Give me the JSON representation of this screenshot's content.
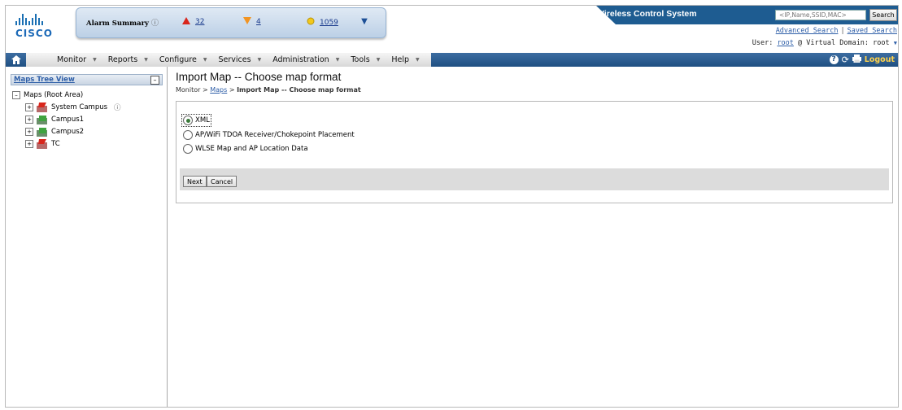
{
  "header": {
    "logo_text": "CISCO",
    "alarm_summary": {
      "label": "Alarm Summary",
      "critical_count": "32",
      "major_count": "4",
      "minor_count": "1059"
    },
    "product_title": "Wireless Control System",
    "search": {
      "placeholder": "<IP,Name,SSID,MAC>",
      "button_label": "Search"
    },
    "links": {
      "advanced_search": "Advanced Search",
      "separator": "|",
      "saved_search": "Saved Search"
    },
    "user": {
      "label": "User:",
      "name": "root",
      "domain_label": "@ Virtual Domain:",
      "domain": "root"
    }
  },
  "nav": {
    "items": [
      "Monitor",
      "Reports",
      "Configure",
      "Services",
      "Administration",
      "Tools",
      "Help"
    ],
    "logout": "Logout"
  },
  "tree": {
    "title": "Maps Tree View",
    "root": "Maps (Root Area)",
    "nodes": [
      {
        "label": "System Campus",
        "icon": "campus-alarm-icon"
      },
      {
        "label": "Campus1",
        "icon": "campus-ok-icon"
      },
      {
        "label": "Campus2",
        "icon": "campus-ok-icon"
      },
      {
        "label": "TC",
        "icon": "campus-alarm-icon"
      }
    ]
  },
  "page": {
    "title": "Import Map -- Choose map format",
    "breadcrumb": {
      "monitor": "Monitor",
      "sep1": ">",
      "maps": "Maps",
      "sep2": ">",
      "current": "Import Map -- Choose map format"
    },
    "options": [
      {
        "label": "XML",
        "selected": true
      },
      {
        "label": "AP/WiFi TDOA Receiver/Chokepoint Placement",
        "selected": false
      },
      {
        "label": "WLSE Map and AP Location Data",
        "selected": false
      }
    ],
    "next_label": "Next",
    "cancel_label": "Cancel"
  },
  "colors": {
    "nav_blue": "#1f4f82",
    "link_blue": "#2f5fa8",
    "critical_red": "#d9261c",
    "major_orange": "#f29422",
    "minor_yellow": "#f2c81a"
  }
}
